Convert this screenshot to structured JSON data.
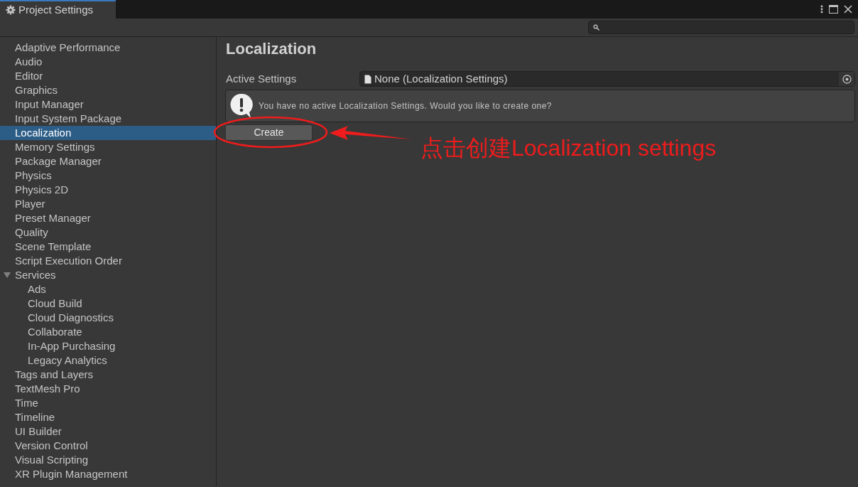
{
  "window": {
    "tab_title": "Project Settings"
  },
  "sidebar": {
    "items": [
      {
        "label": "Adaptive Performance",
        "selected": false
      },
      {
        "label": "Audio",
        "selected": false
      },
      {
        "label": "Editor",
        "selected": false
      },
      {
        "label": "Graphics",
        "selected": false
      },
      {
        "label": "Input Manager",
        "selected": false
      },
      {
        "label": "Input System Package",
        "selected": false
      },
      {
        "label": "Localization",
        "selected": true
      },
      {
        "label": "Memory Settings",
        "selected": false
      },
      {
        "label": "Package Manager",
        "selected": false
      },
      {
        "label": "Physics",
        "selected": false
      },
      {
        "label": "Physics 2D",
        "selected": false
      },
      {
        "label": "Player",
        "selected": false
      },
      {
        "label": "Preset Manager",
        "selected": false
      },
      {
        "label": "Quality",
        "selected": false
      },
      {
        "label": "Scene Template",
        "selected": false
      },
      {
        "label": "Script Execution Order",
        "selected": false
      },
      {
        "label": "Services",
        "selected": false,
        "expanded": true,
        "children": [
          {
            "label": "Ads",
            "selected": false
          },
          {
            "label": "Cloud Build",
            "selected": false
          },
          {
            "label": "Cloud Diagnostics",
            "selected": false
          },
          {
            "label": "Collaborate",
            "selected": false
          },
          {
            "label": "In-App Purchasing",
            "selected": false
          },
          {
            "label": "Legacy Analytics",
            "selected": false
          }
        ]
      },
      {
        "label": "Tags and Layers",
        "selected": false
      },
      {
        "label": "TextMesh Pro",
        "selected": false
      },
      {
        "label": "Time",
        "selected": false
      },
      {
        "label": "Timeline",
        "selected": false
      },
      {
        "label": "UI Builder",
        "selected": false
      },
      {
        "label": "Version Control",
        "selected": false
      },
      {
        "label": "Visual Scripting",
        "selected": false
      },
      {
        "label": "XR Plugin Management",
        "selected": false
      }
    ]
  },
  "content": {
    "title": "Localization",
    "field_label": "Active Settings",
    "field_value": "None (Localization Settings)",
    "warning": "You have no active Localization Settings. Would you like to create one?",
    "button": "Create"
  },
  "annotation": {
    "text": "点击创建Localization settings"
  }
}
